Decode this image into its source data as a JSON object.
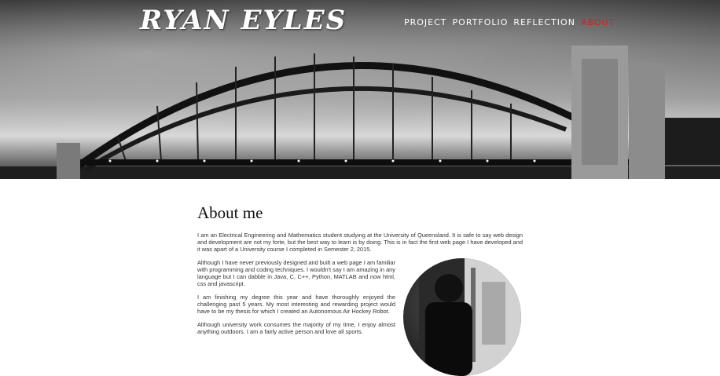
{
  "header": {
    "logo_text": "RYAN EYLES",
    "nav": [
      {
        "label": "PROJECT",
        "active": false
      },
      {
        "label": "PORTFOLIO",
        "active": false
      },
      {
        "label": "REFLECTION",
        "active": false
      },
      {
        "label": "ABOUT",
        "active": true
      }
    ],
    "active_color": "#e01a1a"
  },
  "about": {
    "title": "About me",
    "intro": "I am an Electrical Engineering and Mathematics student studying at the University of Queensland. It is safe to say web design and development are not my forte, but the best way to learn is by doing. This is in fact the first web page I have developed and it was apart of a University course I completed in Semester 2, 2015.",
    "para2": "Although I have never previously designed and built a web page I am familiar with programming and coding techniques. I wouldn't say I am amazing in any language but I can dabble in Java, C, C++, Python, MATLAB and now html, css and javascript.",
    "para3": "I am finishing my degree this year and have thoroughly enjoyed the challenging past 5 years. My most interesting and rewarding project would have to be my thesis for which I created an Autonomous Air Hockey Robot.",
    "para4": "Although university work consumes the majority of my time, I enjoy almost anything outdoors. I am a fairly active person and love all sports."
  }
}
